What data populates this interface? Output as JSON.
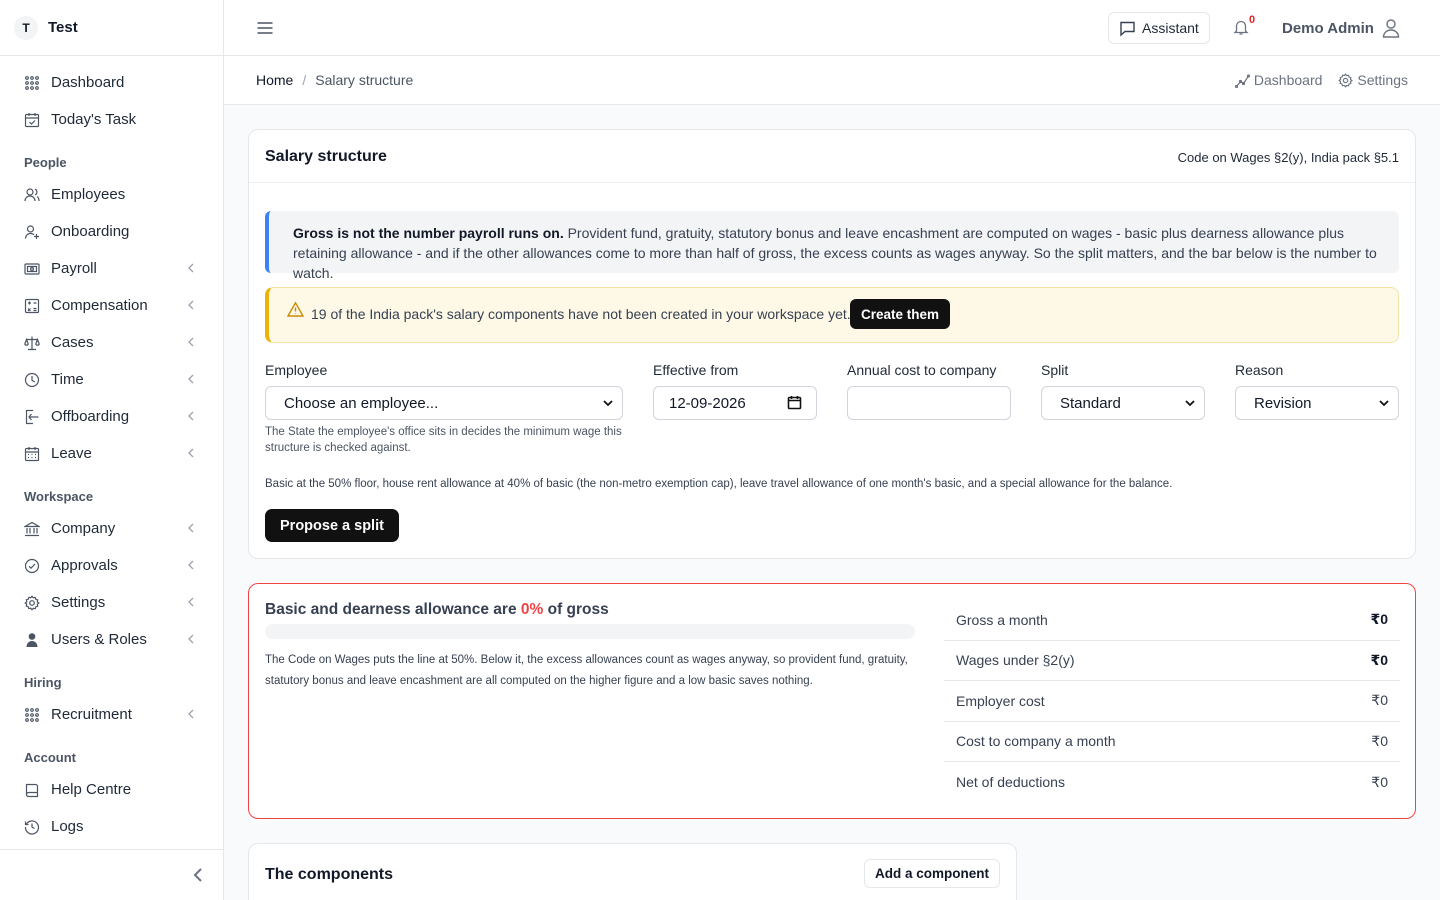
{
  "brand": {
    "initial": "T",
    "name": "Test"
  },
  "nav": {
    "top": [
      {
        "label": "Dashboard",
        "icon": "grid-icon"
      },
      {
        "label": "Today's Task",
        "icon": "calendar-check-icon"
      }
    ],
    "people_title": "People",
    "people": [
      {
        "label": "Employees",
        "icon": "users-icon"
      },
      {
        "label": "Onboarding",
        "icon": "user-plus-icon"
      },
      {
        "label": "Payroll",
        "icon": "money-icon"
      },
      {
        "label": "Compensation",
        "icon": "calculator-icon"
      },
      {
        "label": "Cases",
        "icon": "scale-icon"
      },
      {
        "label": "Time",
        "icon": "clock-icon"
      },
      {
        "label": "Offboarding",
        "icon": "logout-icon"
      },
      {
        "label": "Leave",
        "icon": "calendar-icon"
      }
    ],
    "workspace_title": "Workspace",
    "workspace": [
      {
        "label": "Company",
        "icon": "bank-icon"
      },
      {
        "label": "Approvals",
        "icon": "check-circle-icon"
      },
      {
        "label": "Settings",
        "icon": "gear-icon"
      },
      {
        "label": "Users & Roles",
        "icon": "user-shield-icon"
      }
    ],
    "hiring_title": "Hiring",
    "hiring": [
      {
        "label": "Recruitment",
        "icon": "grid-icon"
      }
    ],
    "account_title": "Account",
    "account": [
      {
        "label": "Help Centre",
        "icon": "book-icon"
      },
      {
        "label": "Logs",
        "icon": "history-icon"
      }
    ]
  },
  "topbar": {
    "assistant_label": "Assistant",
    "notification_count": "0",
    "user_name": "Demo Admin"
  },
  "breadcrumb": {
    "home": "Home",
    "separator": "/",
    "current": "Salary structure",
    "actions": [
      "Dashboard",
      "Settings"
    ]
  },
  "structure": {
    "title": "Salary structure",
    "reference": "Code on Wages §2(y), India pack §5.1",
    "info_bold": "Gross is not the number payroll runs on.",
    "info_text": " Provident fund, gratuity, statutory bonus and leave encashment are computed on wages - basic plus dearness allowance plus retaining allowance - and if the other allowances come to more than half of gross, the excess counts as wages anyway. So the split matters, and the bar below is the number to watch.",
    "warning_text": "19 of the India pack's salary components have not been created in your workspace yet.",
    "warning_button": "Create them",
    "fields": {
      "employee_label": "Employee",
      "employee_value": "Choose an employee...",
      "employee_help": "The State the employee's office sits in decides the minimum wage this structure is checked against.",
      "effective_label": "Effective from",
      "effective_value": "12-09-2026",
      "ctc_label": "Annual cost to company",
      "ctc_value": "",
      "split_label": "Split",
      "split_value": "Standard",
      "reason_label": "Reason",
      "reason_value": "Revision"
    },
    "split_note": "Basic at the 50% floor, house rent allowance at 40% of basic (the non-metro exemption cap), leave travel allowance of one month's basic, and a special allowance for the balance.",
    "propose_button": "Propose a split"
  },
  "ratio": {
    "title_prefix": "Basic and dearness allowance are ",
    "percent": "0%",
    "percent_value": 0,
    "title_suffix": " of gross",
    "note": "The Code on Wages puts the line at 50%. Below it, the excess allowances count as wages anyway, so provident fund, gratuity, statutory bonus and leave encashment are all computed on the higher figure and a low basic saves nothing.",
    "totals": [
      {
        "label": "Gross a month",
        "value": "₹0",
        "strong": true
      },
      {
        "label": "Wages under §2(y)",
        "value": "₹0",
        "strong": true
      },
      {
        "label": "Employer cost",
        "value": "₹0",
        "strong": false
      },
      {
        "label": "Cost to company a month",
        "value": "₹0",
        "strong": false
      },
      {
        "label": "Net of deductions",
        "value": "₹0",
        "strong": false
      }
    ]
  },
  "components": {
    "title": "The components",
    "add_button": "Add a component"
  },
  "colors": {
    "accent_blue": "#3b82f6",
    "danger": "#ef4444",
    "warning": "#eab308"
  }
}
